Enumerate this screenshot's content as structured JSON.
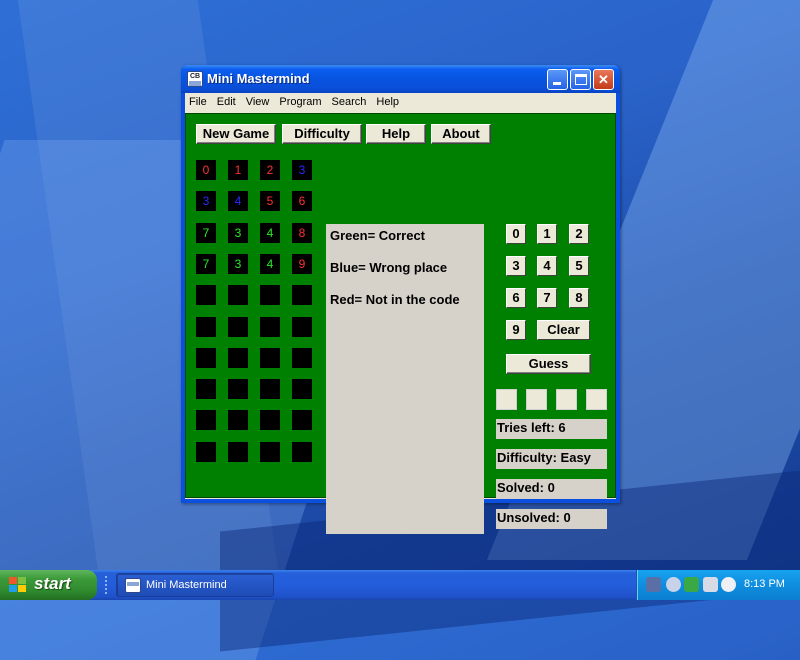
{
  "window": {
    "title": "Mini Mastermind",
    "app_icon_text": "CB",
    "controls": {
      "minimize_glyph": "",
      "maximize_glyph": "",
      "close_glyph": "✕"
    }
  },
  "menu": [
    "File",
    "Edit",
    "View",
    "Program",
    "Search",
    "Help"
  ],
  "toolbar": {
    "new_game": "New Game",
    "difficulty": "Difficulty",
    "help": "Help",
    "about": "About"
  },
  "board": {
    "rows": [
      [
        {
          "v": "0",
          "color": "#ff3030"
        },
        {
          "v": "1",
          "color": "#ff3030"
        },
        {
          "v": "2",
          "color": "#ff3030"
        },
        {
          "v": "3",
          "color": "#2828ff"
        }
      ],
      [
        {
          "v": "3",
          "color": "#2828ff"
        },
        {
          "v": "4",
          "color": "#2828ff"
        },
        {
          "v": "5",
          "color": "#ff3030"
        },
        {
          "v": "6",
          "color": "#ff3030"
        }
      ],
      [
        {
          "v": "7",
          "color": "#22ee22"
        },
        {
          "v": "3",
          "color": "#22ee22"
        },
        {
          "v": "4",
          "color": "#22ee22"
        },
        {
          "v": "8",
          "color": "#ff3030"
        }
      ],
      [
        {
          "v": "7",
          "color": "#22ee22"
        },
        {
          "v": "3",
          "color": "#22ee22"
        },
        {
          "v": "4",
          "color": "#22ee22"
        },
        {
          "v": "9",
          "color": "#ff3030"
        }
      ],
      [
        {
          "v": "",
          "color": ""
        },
        {
          "v": "",
          "color": ""
        },
        {
          "v": "",
          "color": ""
        },
        {
          "v": "",
          "color": ""
        }
      ],
      [
        {
          "v": "",
          "color": ""
        },
        {
          "v": "",
          "color": ""
        },
        {
          "v": "",
          "color": ""
        },
        {
          "v": "",
          "color": ""
        }
      ],
      [
        {
          "v": "",
          "color": ""
        },
        {
          "v": "",
          "color": ""
        },
        {
          "v": "",
          "color": ""
        },
        {
          "v": "",
          "color": ""
        }
      ],
      [
        {
          "v": "",
          "color": ""
        },
        {
          "v": "",
          "color": ""
        },
        {
          "v": "",
          "color": ""
        },
        {
          "v": "",
          "color": ""
        }
      ],
      [
        {
          "v": "",
          "color": ""
        },
        {
          "v": "",
          "color": ""
        },
        {
          "v": "",
          "color": ""
        },
        {
          "v": "",
          "color": ""
        }
      ],
      [
        {
          "v": "",
          "color": ""
        },
        {
          "v": "",
          "color": ""
        },
        {
          "v": "",
          "color": ""
        },
        {
          "v": "",
          "color": ""
        }
      ]
    ]
  },
  "legend": {
    "green": "Green= Correct",
    "blue": "Blue= Wrong place",
    "red": "Red= Not in the code"
  },
  "keypad": {
    "digits": [
      "0",
      "1",
      "2",
      "3",
      "4",
      "5",
      "6",
      "7",
      "8",
      "9"
    ],
    "clear": "Clear",
    "guess": "Guess"
  },
  "guess_slots": [
    "",
    "",
    "",
    ""
  ],
  "stats": {
    "tries_left": "Tries left: 6",
    "difficulty": "Difficulty: Easy",
    "solved": "Solved: 0",
    "unsolved": "Unsolved: 0"
  },
  "taskbar": {
    "start": "start",
    "task_label": "Mini Mastermind",
    "clock": "8:13 PM"
  }
}
